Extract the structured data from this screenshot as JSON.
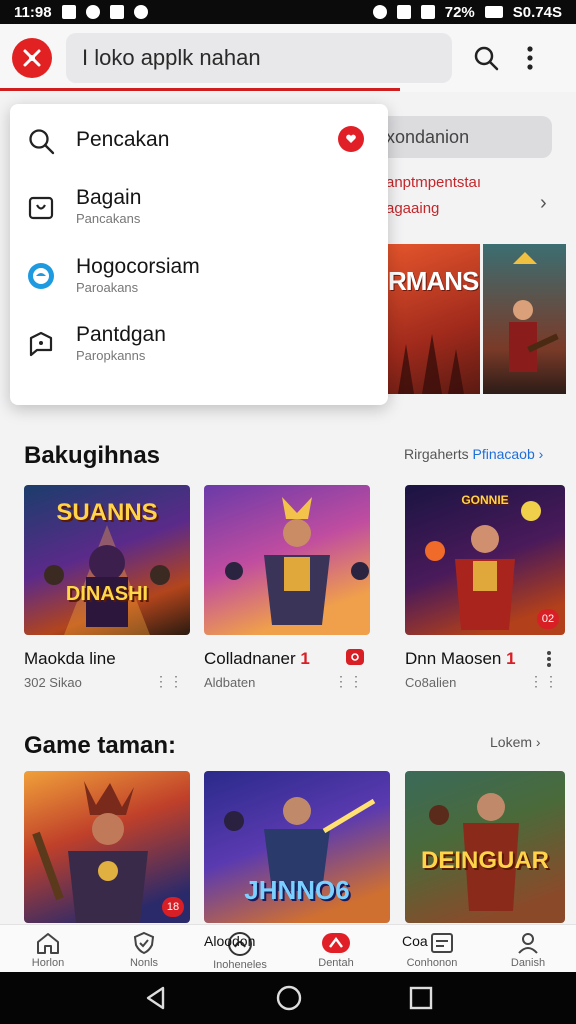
{
  "status_bar": {
    "time": "11:98",
    "battery": "72%",
    "right_text": "S0.74S"
  },
  "search": {
    "value": "I loko applk nahan"
  },
  "dropdown": {
    "items": [
      {
        "title": "Pencakan",
        "subtitle": ""
      },
      {
        "title": "Bagain",
        "subtitle": "Pancakans"
      },
      {
        "title": "Hogocorsiam",
        "subtitle": "Paroakans"
      },
      {
        "title": "Pantdgan",
        "subtitle": "Paropkanns"
      }
    ]
  },
  "behind": {
    "pill": "xondanion",
    "promo_line1": "anptmpentstaı",
    "promo_line2": "agaaing",
    "banner_text": "RMANS"
  },
  "section1": {
    "title": "Bakugihnas",
    "link_prefix": "Rirgaherts",
    "link_blue": "Pfinacaob",
    "cards": [
      {
        "image_text": "SUANNS",
        "image_text2": "DINASHI",
        "title": "Maokda line",
        "subtitle": "302 Sikao",
        "badge": ""
      },
      {
        "image_text": "",
        "image_text2": "",
        "title": "Colladnaner",
        "mark": "1",
        "subtitle": "Aldbaten",
        "badge": ""
      },
      {
        "image_text": "GONNIE",
        "image_text2": "",
        "title": "Dnn Maosen",
        "mark": "1",
        "subtitle": "Co8alien",
        "badge": "02"
      }
    ]
  },
  "section2": {
    "title": "Game taman:",
    "link": "Lokem",
    "cards": [
      {
        "image_text": "",
        "badge": "18"
      },
      {
        "image_text": "JHNNO6",
        "badge": ""
      },
      {
        "image_text": "DEINGUAR",
        "badge": ""
      }
    ]
  },
  "bottom_nav": {
    "items": [
      {
        "label": "Horlon",
        "overlay": ""
      },
      {
        "label": "Nonls",
        "overlay": ""
      },
      {
        "label": "Inoheneles",
        "overlay": "Aloodon"
      },
      {
        "label": "Dentah",
        "overlay": ""
      },
      {
        "label": "Conhonon",
        "overlay": "Coa"
      },
      {
        "label": "Danish",
        "overlay": ""
      }
    ]
  },
  "colors": {
    "accent": "#e01f26",
    "link_blue": "#1e6fd9",
    "background": "#f3f3f4"
  },
  "icons": [
    "logo-icon",
    "search-icon",
    "more-vert-icon",
    "bag-icon",
    "globe-icon",
    "chat-icon",
    "home-icon",
    "shield-icon",
    "notification-icon",
    "profile-icon",
    "back-icon",
    "home-circle-icon",
    "recents-icon"
  ]
}
